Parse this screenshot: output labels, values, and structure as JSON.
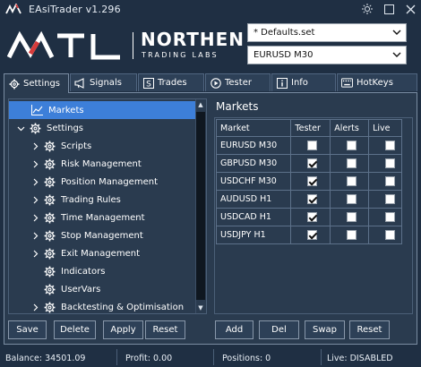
{
  "window": {
    "title": "EAsiTrader v1.296",
    "controls": [
      "sun-icon",
      "restore-icon",
      "close-icon"
    ]
  },
  "brand": {
    "name": "NORTHEN",
    "subtitle": "TRADING LABS"
  },
  "selects": {
    "settings_file": "* Defaults.set",
    "market": "EURUSD M30"
  },
  "tabs": [
    {
      "label": "Settings",
      "icon": "gear-icon",
      "active": true
    },
    {
      "label": "Signals",
      "icon": "megaphone-icon",
      "active": false
    },
    {
      "label": "Trades",
      "icon": "dollar-icon",
      "active": false
    },
    {
      "label": "Tester",
      "icon": "play-icon",
      "active": false
    },
    {
      "label": "Info",
      "icon": "info-icon",
      "active": false
    },
    {
      "label": "HotKeys",
      "icon": "keyboard-icon",
      "active": false
    }
  ],
  "tree": {
    "items": [
      {
        "label": "Markets",
        "icon": "chart-icon",
        "selected": true
      },
      {
        "label": "Settings",
        "icon": "gear-icon",
        "expanded": true
      },
      {
        "label": "Scripts",
        "icon": "gear-icon"
      },
      {
        "label": "Risk Management",
        "icon": "gear-icon"
      },
      {
        "label": "Position Management",
        "icon": "gear-icon"
      },
      {
        "label": "Trading Rules",
        "icon": "gear-icon"
      },
      {
        "label": "Time Management",
        "icon": "gear-icon"
      },
      {
        "label": "Stop Management",
        "icon": "gear-icon"
      },
      {
        "label": "Exit Management",
        "icon": "gear-icon"
      },
      {
        "label": "Indicators",
        "icon": "gear-icon"
      },
      {
        "label": "UserVars",
        "icon": "gear-icon"
      },
      {
        "label": "Backtesting & Optimisation",
        "icon": "gear-icon"
      }
    ]
  },
  "markets": {
    "title": "Markets",
    "columns": [
      "Market",
      "Tester",
      "Alerts",
      "Live"
    ],
    "rows": [
      {
        "market": "EURUSD M30",
        "tester": false,
        "alerts": false,
        "live": false
      },
      {
        "market": "GBPUSD M30",
        "tester": true,
        "alerts": false,
        "live": false
      },
      {
        "market": "USDCHF M30",
        "tester": true,
        "alerts": false,
        "live": false
      },
      {
        "market": "AUDUSD H1",
        "tester": true,
        "alerts": false,
        "live": false
      },
      {
        "market": "USDCAD H1",
        "tester": true,
        "alerts": false,
        "live": false
      },
      {
        "market": "USDJPY H1",
        "tester": true,
        "alerts": false,
        "live": false
      }
    ]
  },
  "settings_buttons": {
    "save": "Save",
    "delete": "Delete",
    "apply": "Apply",
    "reset": "Reset"
  },
  "market_buttons": {
    "add": "Add",
    "del": "Del",
    "swap": "Swap",
    "reset": "Reset"
  },
  "status": {
    "balance": "Balance: 34501.09",
    "profit": "Profit: 0.00",
    "positions": "Positions: 0",
    "live": "Live: DISABLED"
  },
  "colors": {
    "background": "#1f2f43",
    "panel": "#2a3b4f",
    "selection": "#3d7fd9"
  }
}
